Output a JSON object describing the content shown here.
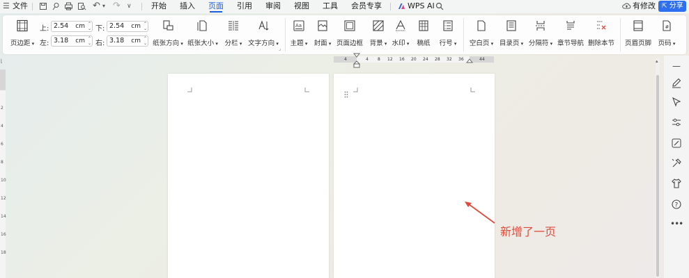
{
  "menubar": {
    "file": "文件",
    "tabs": [
      "开始",
      "插入",
      "页面",
      "引用",
      "审阅",
      "视图",
      "工具",
      "会员专享"
    ],
    "active_tab": "页面",
    "wps_ai": "WPS AI",
    "modified": "有修改",
    "share": "分享"
  },
  "ribbon": {
    "margins": "页边距",
    "top_label": "上:",
    "top_value": "2.54",
    "bottom_label": "下:",
    "bottom_value": "2.54",
    "left_label": "左:",
    "left_value": "3.18",
    "right_label": "右:",
    "right_value": "3.18",
    "unit": "cm",
    "orientation": "纸张方向",
    "size": "纸张大小",
    "columns": "分栏",
    "text_direction": "文字方向",
    "theme": "主题",
    "cover": "封面",
    "page_border": "页面边框",
    "background": "背景",
    "watermark": "水印",
    "manuscript": "稿纸",
    "line_number": "行号",
    "blank_page": "空白页",
    "toc_page": "目录页",
    "separator": "分隔符",
    "section_nav": "章节导航",
    "delete_section": "删除本节",
    "header_footer": "页眉页脚",
    "page_number": "页码"
  },
  "ruler": {
    "ticks": [
      "4",
      "4",
      "8",
      "12",
      "16",
      "20",
      "24",
      "28",
      "32",
      "36",
      "44"
    ]
  },
  "left_ruler": [
    "2",
    "4",
    "6",
    "8",
    "10",
    "12",
    "14",
    "16",
    "18"
  ],
  "annotation": {
    "text": "新增了一页",
    "color": "#e04a3a"
  },
  "colors": {
    "accent": "#1a5ee0",
    "share_bg": "#2d6ff0"
  }
}
